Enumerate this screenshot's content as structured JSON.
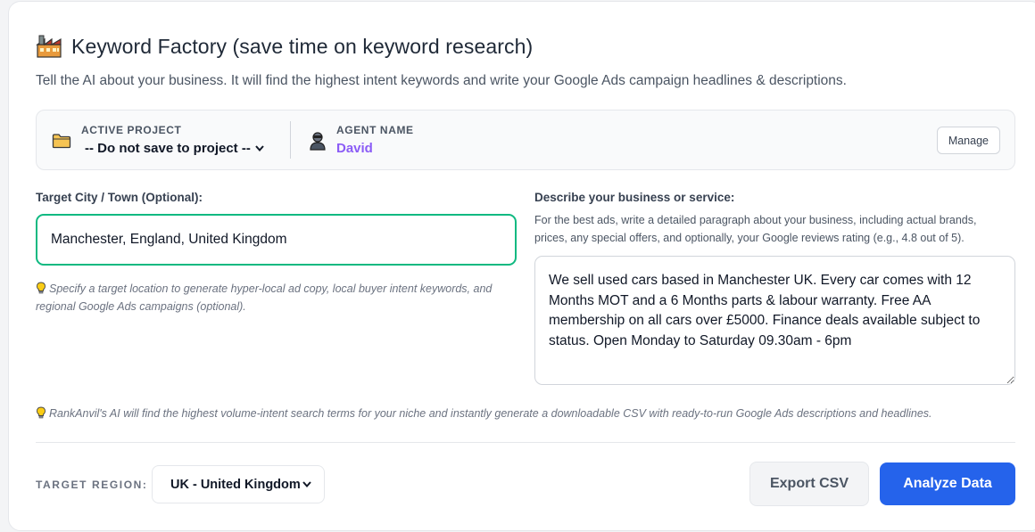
{
  "header": {
    "icon": "factory-icon",
    "title": "Keyword Factory (save time on keyword research)",
    "subtitle": "Tell the AI about your business. It will find the highest intent keywords and write your Google Ads campaign headlines & descriptions."
  },
  "project_bar": {
    "folder_icon": "folder-icon",
    "active_project_label": "ACTIVE PROJECT",
    "active_project_value": "-- Do not save to project --",
    "agent_icon": "user-icon",
    "agent_name_label": "AGENT NAME",
    "agent_name_value": "David",
    "manage_label": "Manage"
  },
  "city": {
    "label": "Target City / Town (Optional):",
    "value": "Manchester, England, United Kingdom",
    "hint": "Specify a target location to generate hyper-local ad copy, local buyer intent keywords, and regional Google Ads campaigns (optional)."
  },
  "business": {
    "label": "Describe your business or service:",
    "help": "For the best ads, write a detailed paragraph about your business, including actual brands, prices, any special offers, and optionally, your Google reviews rating (e.g., 4.8 out of 5).",
    "value": "We sell used cars based in Manchester UK. Every car comes with 12 Months MOT and a 6 Months parts & labour warranty. Free AA membership on all cars over £5000. Finance deals available subject to status. Open Monday to Saturday 09.30am - 6pm"
  },
  "info_hint": "RankAnvil's AI will find the highest volume-intent search terms for your niche and instantly generate a downloadable CSV with ready-to-run Google Ads descriptions and headlines.",
  "footer": {
    "region_label": "TARGET REGION:",
    "region_value": "UK - United Kingdom",
    "export_label": "Export CSV",
    "analyze_label": "Analyze Data"
  },
  "colors": {
    "accent_blue": "#2563eb",
    "input_focus_green": "#10b981",
    "agent_purple": "#8b5cf6"
  }
}
